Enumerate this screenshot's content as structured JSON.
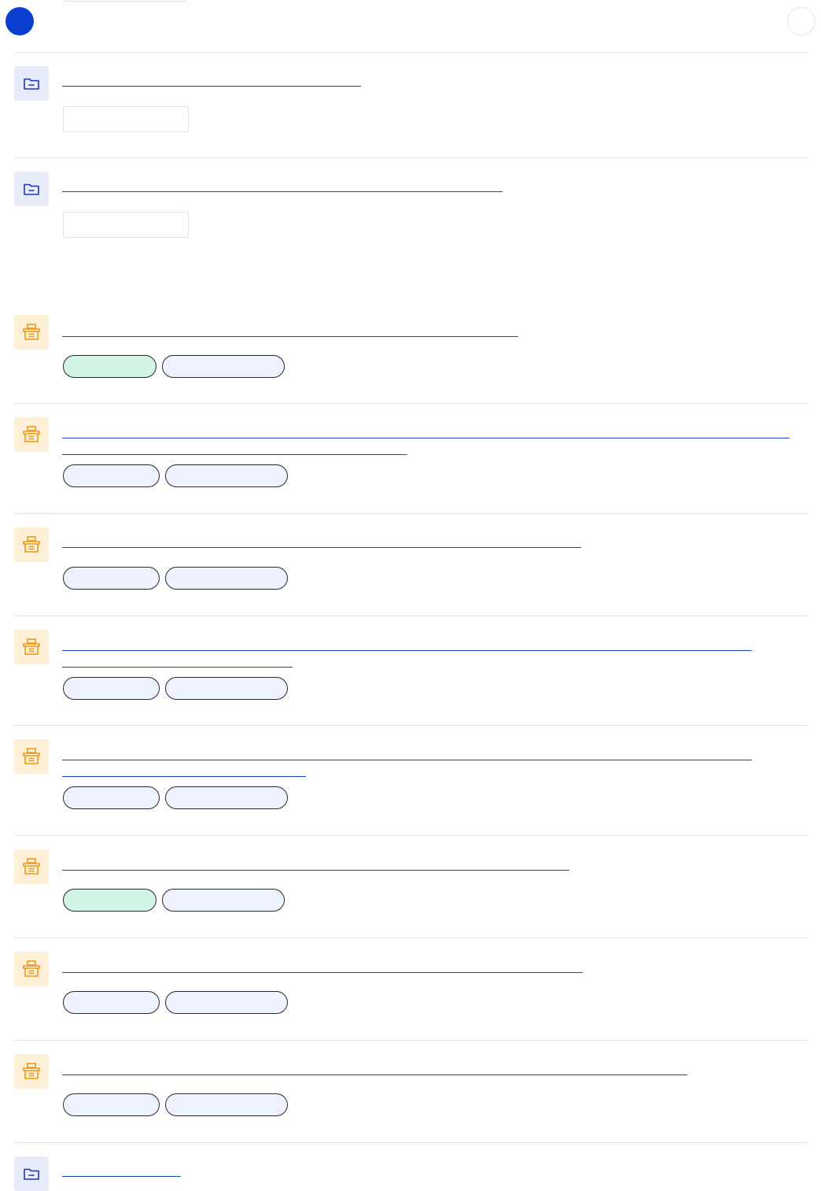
{
  "colors": {
    "accent": "#0a3fcf",
    "link": "#1549b8",
    "folder_tile": "#e8ebfa",
    "archive_tile": "#fdf0d6",
    "icon_folder": "#1c3aa9",
    "icon_archive": "#e99a1a",
    "pill_green": "#d3f5e5",
    "pill_blue": "#eef2fe",
    "divider": "#e3e3e3"
  },
  "header": {
    "primary_action_icon": "circle-filled",
    "secondary_action_icon": "circle-outline"
  },
  "folders": [
    {
      "icon": "folder-icon",
      "tag_input": ""
    },
    {
      "icon": "folder-icon",
      "tag_input": ""
    }
  ],
  "records": [
    {
      "icon": "archive-box-icon",
      "tags": [
        {
          "color": "green",
          "label": ""
        },
        {
          "color": "blue",
          "label": ""
        }
      ]
    },
    {
      "icon": "archive-box-icon",
      "tags": [
        {
          "color": "blue",
          "label": ""
        },
        {
          "color": "blue",
          "label": ""
        }
      ]
    },
    {
      "icon": "archive-box-icon",
      "tags": [
        {
          "color": "blue",
          "label": ""
        },
        {
          "color": "blue",
          "label": ""
        }
      ]
    },
    {
      "icon": "archive-box-icon",
      "tags": [
        {
          "color": "blue",
          "label": ""
        },
        {
          "color": "blue",
          "label": ""
        }
      ]
    },
    {
      "icon": "archive-box-icon",
      "tags": [
        {
          "color": "blue",
          "label": ""
        },
        {
          "color": "blue",
          "label": ""
        }
      ]
    },
    {
      "icon": "archive-box-icon",
      "tags": [
        {
          "color": "green",
          "label": ""
        },
        {
          "color": "blue",
          "label": ""
        }
      ]
    },
    {
      "icon": "archive-box-icon",
      "tags": [
        {
          "color": "blue",
          "label": ""
        },
        {
          "color": "blue",
          "label": ""
        }
      ]
    },
    {
      "icon": "archive-box-icon",
      "tags": [
        {
          "color": "blue",
          "label": ""
        },
        {
          "color": "blue",
          "label": ""
        }
      ]
    }
  ],
  "last_folder": {
    "icon": "folder-icon"
  }
}
